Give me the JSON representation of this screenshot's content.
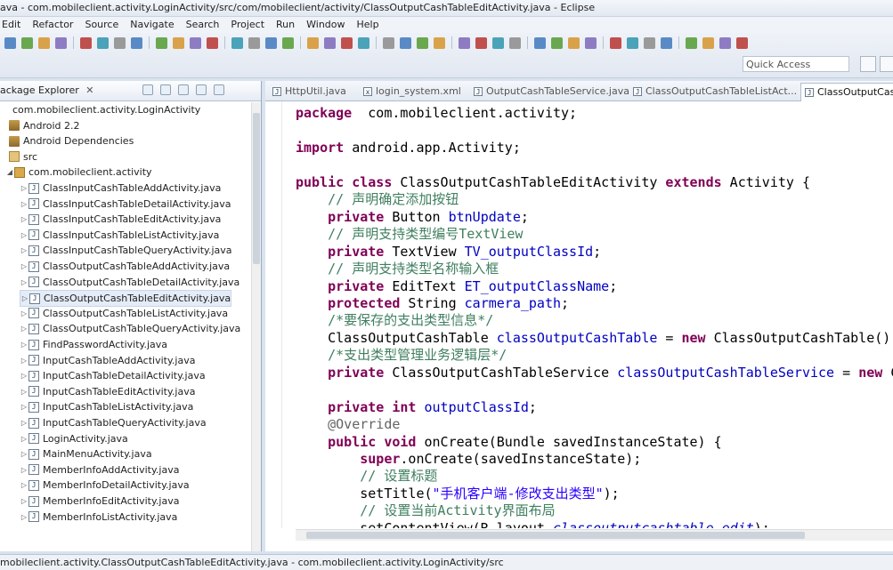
{
  "window": {
    "title": "ava - com.mobileclient.activity.LoginActivity/src/com/mobileclient/activity/ClassOutputCashTableEditActivity.java - Eclipse"
  },
  "menu": [
    "Edit",
    "Refactor",
    "Source",
    "Navigate",
    "Search",
    "Project",
    "Run",
    "Window",
    "Help"
  ],
  "toolbar": {
    "quick_access_placeholder": "Quick Access"
  },
  "package_explorer": {
    "title": "ackage Explorer",
    "close": "✕",
    "tree": [
      {
        "label": "com.mobileclient.activity.LoginActivity",
        "icon": "project-icon",
        "indent": 0
      },
      {
        "label": "Android 2.2",
        "icon": "library-icon",
        "indent": 1
      },
      {
        "label": "Android Dependencies",
        "icon": "library-icon",
        "indent": 1
      },
      {
        "label": "src",
        "icon": "source-folder-icon",
        "indent": 1
      },
      {
        "label": "com.mobileclient.activity",
        "icon": "package-icon",
        "indent": 2
      },
      {
        "label": "ClassInputCashTableAddActivity.java",
        "icon": "java-file-icon",
        "indent": 3
      },
      {
        "label": "ClassInputCashTableDetailActivity.java",
        "icon": "java-file-icon",
        "indent": 3
      },
      {
        "label": "ClassInputCashTableEditActivity.java",
        "icon": "java-file-icon",
        "indent": 3
      },
      {
        "label": "ClassInputCashTableListActivity.java",
        "icon": "java-file-icon",
        "indent": 3
      },
      {
        "label": "ClassInputCashTableQueryActivity.java",
        "icon": "java-file-icon",
        "indent": 3
      },
      {
        "label": "ClassOutputCashTableAddActivity.java",
        "icon": "java-file-icon",
        "indent": 3
      },
      {
        "label": "ClassOutputCashTableDetailActivity.java",
        "icon": "java-file-icon",
        "indent": 3
      },
      {
        "label": "ClassOutputCashTableEditActivity.java",
        "icon": "java-file-icon",
        "indent": 3,
        "selected": true
      },
      {
        "label": "ClassOutputCashTableListActivity.java",
        "icon": "java-file-icon",
        "indent": 3
      },
      {
        "label": "ClassOutputCashTableQueryActivity.java",
        "icon": "java-file-icon",
        "indent": 3
      },
      {
        "label": "FindPasswordActivity.java",
        "icon": "java-file-icon",
        "indent": 3
      },
      {
        "label": "InputCashTableAddActivity.java",
        "icon": "java-file-icon",
        "indent": 3
      },
      {
        "label": "InputCashTableDetailActivity.java",
        "icon": "java-file-icon",
        "indent": 3
      },
      {
        "label": "InputCashTableEditActivity.java",
        "icon": "java-file-icon",
        "indent": 3
      },
      {
        "label": "InputCashTableListActivity.java",
        "icon": "java-file-icon",
        "indent": 3
      },
      {
        "label": "InputCashTableQueryActivity.java",
        "icon": "java-file-icon",
        "indent": 3
      },
      {
        "label": "LoginActivity.java",
        "icon": "java-file-icon",
        "indent": 3
      },
      {
        "label": "MainMenuActivity.java",
        "icon": "java-file-icon",
        "indent": 3
      },
      {
        "label": "MemberInfoAddActivity.java",
        "icon": "java-file-icon",
        "indent": 3
      },
      {
        "label": "MemberInfoDetailActivity.java",
        "icon": "java-file-icon",
        "indent": 3
      },
      {
        "label": "MemberInfoEditActivity.java",
        "icon": "java-file-icon",
        "indent": 3
      },
      {
        "label": "MemberInfoListActivity.java",
        "icon": "java-file-icon",
        "indent": 3
      }
    ]
  },
  "editor": {
    "tabs": [
      {
        "label": "HttpUtil.java"
      },
      {
        "label": "login_system.xml"
      },
      {
        "label": "OutputCashTableService.java"
      },
      {
        "label": "ClassOutputCashTableListAct..."
      },
      {
        "label": "ClassOutputCashT",
        "active": true
      }
    ],
    "code_lines": [
      [
        [
          "kw",
          "package"
        ],
        [
          "",
          "  com.mobileclient.activity;"
        ]
      ],
      [],
      [
        [
          "kw",
          "import"
        ],
        [
          "",
          " android.app.Activity;"
        ]
      ],
      [],
      [
        [
          "kw",
          "public class"
        ],
        [
          "",
          " ClassOutputCashTableEditActivity "
        ],
        [
          "kw",
          "extends"
        ],
        [
          "",
          " Activity {"
        ]
      ],
      [
        [
          "",
          "    "
        ],
        [
          "cm",
          "// 声明确定添加按钮"
        ]
      ],
      [
        [
          "",
          "    "
        ],
        [
          "kw",
          "private"
        ],
        [
          "",
          " Button "
        ],
        [
          "fd",
          "btnUpdate"
        ],
        [
          "",
          ";"
        ]
      ],
      [
        [
          "",
          "    "
        ],
        [
          "cm",
          "// 声明支持类型编号TextView"
        ]
      ],
      [
        [
          "",
          "    "
        ],
        [
          "kw",
          "private"
        ],
        [
          "",
          " TextView "
        ],
        [
          "fd",
          "TV_outputClassId"
        ],
        [
          "",
          ";"
        ]
      ],
      [
        [
          "",
          "    "
        ],
        [
          "cm",
          "// 声明支持类型名称输入框"
        ]
      ],
      [
        [
          "",
          "    "
        ],
        [
          "kw",
          "private"
        ],
        [
          "",
          " EditText "
        ],
        [
          "fd",
          "ET_outputClassName"
        ],
        [
          "",
          ";"
        ]
      ],
      [
        [
          "",
          "    "
        ],
        [
          "kw",
          "protected"
        ],
        [
          "",
          " String "
        ],
        [
          "fd",
          "carmera_path"
        ],
        [
          "",
          ";"
        ]
      ],
      [
        [
          "",
          "    "
        ],
        [
          "cm",
          "/*要保存的支出类型信息*/"
        ]
      ],
      [
        [
          "",
          "    ClassOutputCashTable "
        ],
        [
          "fd",
          "classOutputCashTable"
        ],
        [
          "",
          " = "
        ],
        [
          "kw",
          "new"
        ],
        [
          "",
          " ClassOutputCashTable();"
        ]
      ],
      [
        [
          "",
          "    "
        ],
        [
          "cm",
          "/*支出类型管理业务逻辑层*/"
        ]
      ],
      [
        [
          "",
          "    "
        ],
        [
          "kw",
          "private"
        ],
        [
          "",
          " ClassOutputCashTableService "
        ],
        [
          "fd",
          "classOutputCashTableService"
        ],
        [
          "",
          " = "
        ],
        [
          "kw",
          "new"
        ],
        [
          "",
          " Cl"
        ]
      ],
      [],
      [
        [
          "",
          "    "
        ],
        [
          "kw",
          "private int"
        ],
        [
          "",
          " "
        ],
        [
          "fd",
          "outputClassId"
        ],
        [
          "",
          ";"
        ]
      ],
      [
        [
          "",
          "    "
        ],
        [
          "an",
          "@Override"
        ]
      ],
      [
        [
          "",
          "    "
        ],
        [
          "kw",
          "public void"
        ],
        [
          "",
          " onCreate(Bundle savedInstanceState) {"
        ]
      ],
      [
        [
          "",
          "        "
        ],
        [
          "kw",
          "super"
        ],
        [
          "",
          ".onCreate(savedInstanceState);"
        ]
      ],
      [
        [
          "",
          "        "
        ],
        [
          "cm",
          "// 设置标题"
        ]
      ],
      [
        [
          "",
          "        setTitle("
        ],
        [
          "st",
          "\"手机客户端-修改支出类型\""
        ],
        [
          "",
          ");"
        ]
      ],
      [
        [
          "",
          "        "
        ],
        [
          "cm",
          "// 设置当前Activity界面布局"
        ]
      ],
      [
        [
          "",
          "        setContentView(R.layout."
        ],
        [
          "it",
          "classoutputcashtable_edit"
        ],
        [
          "",
          ");"
        ]
      ]
    ]
  },
  "status_bar": {
    "text": "mobileclient.activity.ClassOutputCashTableEditActivity.java - com.mobileclient.activity.LoginActivity/src"
  }
}
